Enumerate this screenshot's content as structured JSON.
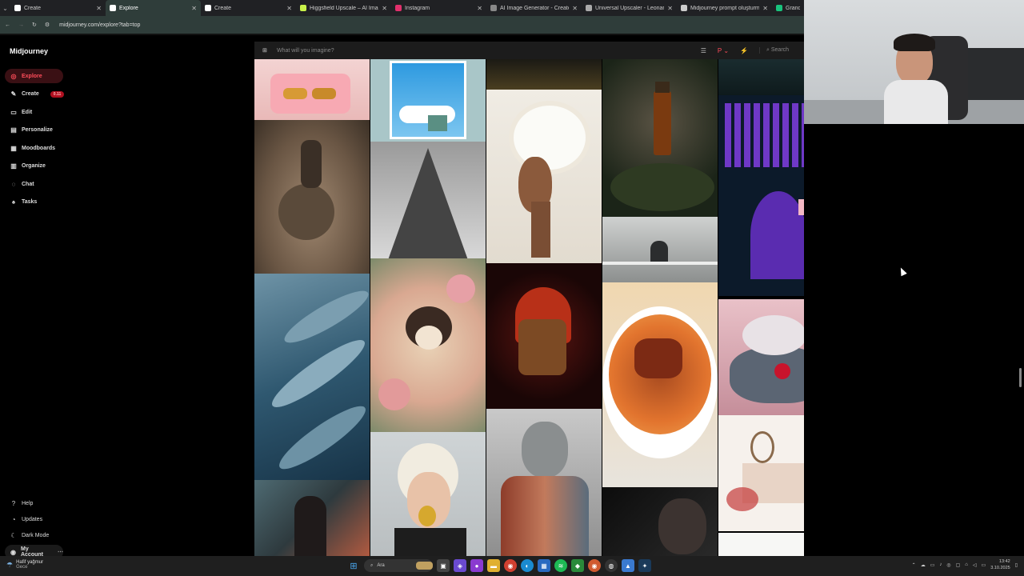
{
  "browser": {
    "tabs": [
      {
        "title": "Create",
        "color": "#ffffff",
        "active": false
      },
      {
        "title": "Explore",
        "color": "#ffffff",
        "active": true
      },
      {
        "title": "Create",
        "color": "#ffffff",
        "active": false
      },
      {
        "title": "Higgsfield Upscale – AI Image",
        "color": "#c8f24a",
        "active": false
      },
      {
        "title": "Instagram",
        "color": "#e1306c",
        "active": false
      },
      {
        "title": "AI Image Generator - Create A",
        "color": "#888888",
        "active": false
      },
      {
        "title": "Universal Upscaler - Leonardo.",
        "color": "#aaaaaa",
        "active": false
      },
      {
        "title": "Midjourney prompt oluşturma",
        "color": "#cccccc",
        "active": false
      },
      {
        "title": "Grand",
        "color": "#19c37d",
        "active": false
      }
    ],
    "url": "midjourney.com/explore?tab=top"
  },
  "sidebar": {
    "brand": "Midjourney",
    "items": [
      {
        "label": "Explore",
        "icon": "compass-icon",
        "glyph": "◎"
      },
      {
        "label": "Create",
        "icon": "brush-icon",
        "glyph": "✎",
        "badge": "0.11"
      },
      {
        "label": "Edit",
        "icon": "edit-icon",
        "glyph": "▭"
      },
      {
        "label": "Personalize",
        "icon": "personalize-icon",
        "glyph": "▤"
      },
      {
        "label": "Moodboards",
        "icon": "moodboard-icon",
        "glyph": "▦"
      },
      {
        "label": "Organize",
        "icon": "folder-icon",
        "glyph": "▥"
      },
      {
        "label": "Chat",
        "icon": "chat-icon",
        "glyph": "◌"
      },
      {
        "label": "Tasks",
        "icon": "thumbs-up-icon",
        "glyph": "♠"
      }
    ],
    "bottom": [
      {
        "label": "Help",
        "glyph": "?"
      },
      {
        "label": "Updates",
        "glyph": "◔"
      },
      {
        "label": "Dark Mode",
        "glyph": "☾"
      }
    ],
    "account": "My Account"
  },
  "prompt_bar": {
    "placeholder": "What will you imagine?",
    "search": "Search"
  },
  "taskbar": {
    "weather_title": "Hafif yağmur",
    "weather_sub": "Gece",
    "search": "Ara",
    "time": "13:42",
    "date": "3.10.2025"
  }
}
